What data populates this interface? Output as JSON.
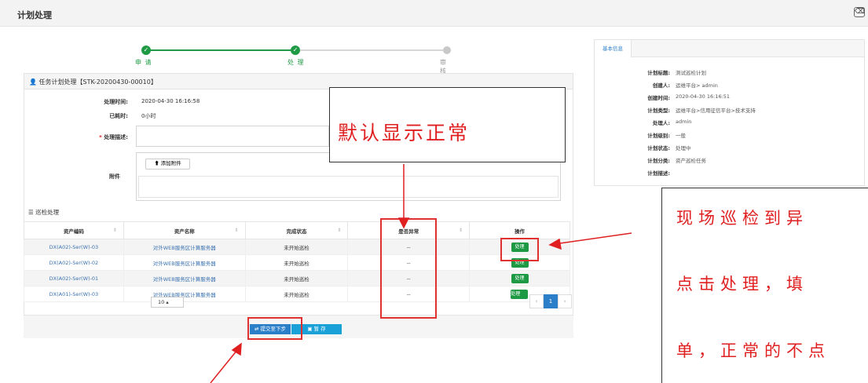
{
  "window": {
    "title": "计划处理",
    "close_icon": "backspace-icon"
  },
  "steps": [
    {
      "label": "申 请",
      "state": "done"
    },
    {
      "label": "处 理",
      "state": "current"
    },
    {
      "label": "审 核",
      "state": "pending"
    }
  ],
  "colors": {
    "done": "#1f9a44",
    "pending": "#c8c8c8",
    "accent": "#2b7fc8",
    "highlight": "#e02020"
  },
  "task_header": "任务计划处理【STK-20200430-00010】",
  "form": {
    "time_label": "处理时间:",
    "time_value": "2020-04-30 16:16:58",
    "spent_label": "已耗时:",
    "spent_value": "0小时",
    "desc_label": "处理描述:",
    "desc_required": "*",
    "attach_label": "附件",
    "attach_button": "添加附件"
  },
  "section": {
    "title": "巡检处理"
  },
  "table": {
    "columns": [
      "资产编码",
      "资产名称",
      "完成状态",
      "是否异常",
      "操作"
    ],
    "rows": [
      {
        "code": "DX(A02)-Ser(W)-03",
        "name": "对外WEB服务区计算服务器",
        "status": "未开始巡检",
        "abnormal": "--",
        "action": "处理"
      },
      {
        "code": "DX(A02)-Ser(W)-02",
        "name": "对外WEB服务区计算服务器",
        "status": "未开始巡检",
        "abnormal": "--",
        "action": "处理"
      },
      {
        "code": "DX(A02)-Ser(W)-01",
        "name": "对外WEB服务区计算服务器",
        "status": "未开始巡检",
        "abnormal": "--",
        "action": "处理"
      },
      {
        "code": "DX(A01)-Ser(W)-03",
        "name": "对外WEB服务区计算服务器",
        "status": "未开始巡检",
        "abnormal": "--",
        "action": "处理"
      }
    ]
  },
  "pager": {
    "page_size": "10",
    "current_page": "1",
    "prev": "‹",
    "next": "›"
  },
  "buttons": {
    "submit": "提交至下步",
    "save": "暂 存"
  },
  "info": {
    "tab": "基本信息",
    "rows": [
      {
        "k": "计划标题:",
        "v": "测试巡检计划"
      },
      {
        "k": "创建人:",
        "v": "运维平台> admin"
      },
      {
        "k": "创建时间:",
        "v": "2020-04-30 16:16:51"
      },
      {
        "k": "计划类型:",
        "v": "运维平台>信用征信平台>技术支持"
      },
      {
        "k": "处理人:",
        "v": "admin"
      },
      {
        "k": "计划级别:",
        "v": "一般"
      },
      {
        "k": "计划状态:",
        "v": "处理中"
      },
      {
        "k": "计划分类:",
        "v": "资产巡检任务"
      },
      {
        "k": "计划描述:",
        "v": ""
      }
    ]
  },
  "annotations": {
    "note1": "默认显示正常",
    "note2_lines": [
      "现场巡检到异",
      "点击处理，填",
      "单，正常的不点"
    ]
  }
}
